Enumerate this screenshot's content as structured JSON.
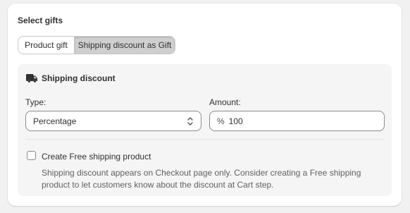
{
  "card": {
    "title": "Select gifts"
  },
  "gift_tabs": {
    "items": [
      {
        "label": "Product gift",
        "selected": false
      },
      {
        "label": "Shipping discount as Gift",
        "selected": true
      }
    ]
  },
  "shipping": {
    "heading": "Shipping discount",
    "heading_icon": "truck-icon",
    "type_label": "Type:",
    "type_value": "Percentage",
    "amount_label": "Amount:",
    "amount_prefix": "%",
    "amount_value": "100",
    "free_product_label": "Create Free shipping product",
    "free_product_checked": false,
    "help_text": "Shipping discount appears on Checkout page only. Consider creating a Free shipping product to let customers know about the discount at Cart step."
  },
  "colors": {
    "background": "#f1f1f1",
    "card": "#ffffff",
    "panel": "#f5f5f5",
    "selected_tab": "#cfcfcf",
    "text": "#303030",
    "muted_text": "#616161",
    "border": "#8a8a8a"
  }
}
